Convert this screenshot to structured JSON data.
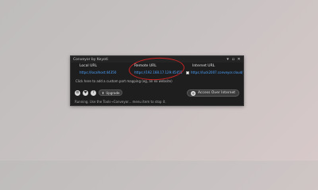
{
  "window": {
    "title": "Conveyor by Keyoti"
  },
  "columns": {
    "local": {
      "header": "Local URL",
      "url": "https://localhost:44350"
    },
    "remote": {
      "header": "Remote URL",
      "url": "https://192.168.17.129:45455"
    },
    "internet": {
      "header": "Internet URL",
      "url": "https://luck2007.conveyor.cloud/"
    }
  },
  "hint": "Click here to add a custom port mapping (eg, an ex website)",
  "toolbar": {
    "upgrade_label": "Upgrade",
    "access_label": "Access Over Internet"
  },
  "status": "Running. Use the Tools→Conveyor... menu item to stop it.",
  "icons": {
    "gear": "gear-icon",
    "heart": "heart-icon",
    "help": "help-icon",
    "globe": "globe-icon"
  },
  "colors": {
    "link": "#4da3ff",
    "annotation": "#c82424",
    "window_bg": "#1e1e1e"
  }
}
